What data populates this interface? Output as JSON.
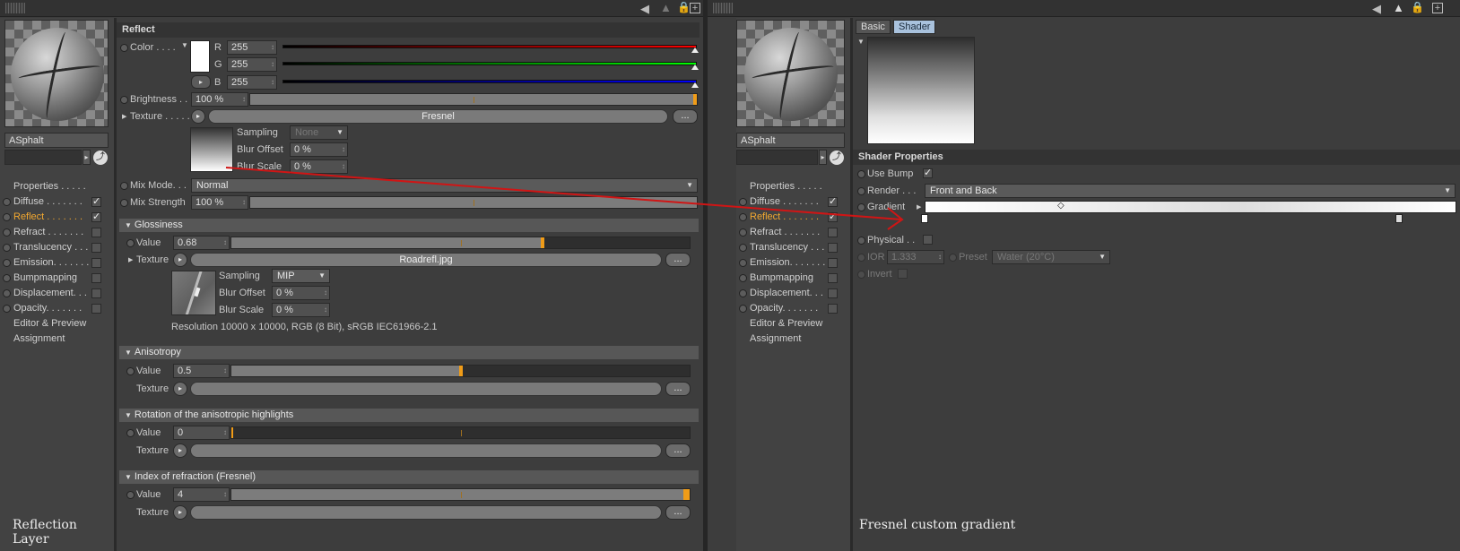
{
  "left": {
    "material_name": "ASphalt",
    "nav": [
      {
        "label": "Properties . . . . .",
        "checked": null,
        "active": false,
        "dot": false
      },
      {
        "label": "Diffuse . . . . . . .",
        "checked": true,
        "active": false,
        "dot": true
      },
      {
        "label": "Reflect . . . . . . .",
        "checked": true,
        "active": true,
        "dot": true
      },
      {
        "label": "Refract . . . . . . .",
        "checked": false,
        "active": false,
        "dot": true
      },
      {
        "label": "Translucency . . .",
        "checked": false,
        "active": false,
        "dot": true
      },
      {
        "label": "Emission. . . . . . .",
        "checked": false,
        "active": false,
        "dot": true
      },
      {
        "label": "Bumpmapping",
        "checked": false,
        "active": false,
        "dot": true
      },
      {
        "label": "Displacement. . .",
        "checked": false,
        "active": false,
        "dot": true
      },
      {
        "label": "Opacity. . . . . . .",
        "checked": false,
        "active": false,
        "dot": true
      },
      {
        "label": "Editor & Preview",
        "checked": null,
        "active": false,
        "dot": false
      },
      {
        "label": "Assignment",
        "checked": null,
        "active": false,
        "dot": false
      }
    ],
    "caption": "Reflection Layer"
  },
  "reflect": {
    "header": "Reflect",
    "color_label": "Color . . . .",
    "r_label": "R",
    "r_value": "255",
    "g_label": "G",
    "g_value": "255",
    "b_label": "B",
    "b_value": "255",
    "brightness_label": "Brightness . .",
    "brightness_value": "100 %",
    "brightness_level": 1.0,
    "texture_label": "Texture . . . . .",
    "texture_name": "Fresnel",
    "more_label": "...",
    "sampling_label": "Sampling",
    "sampling_value": "None",
    "blur_offset_label": "Blur Offset",
    "blur_offset_value": "0 %",
    "blur_scale_label": "Blur Scale",
    "blur_scale_value": "0 %",
    "mix_mode_label": "Mix Mode. . .",
    "mix_mode_value": "Normal",
    "mix_strength_label": "Mix Strength",
    "mix_strength_value": "100 %"
  },
  "glossiness": {
    "header": "Glossiness",
    "value_label": "Value",
    "value": "0.68",
    "level": 0.68,
    "texture_label": "Texture",
    "texture_name": "Roadrefl.jpg",
    "sampling_label": "Sampling",
    "sampling_value": "MIP",
    "blur_offset_label": "Blur Offset",
    "blur_offset_value": "0 %",
    "blur_scale_label": "Blur Scale",
    "blur_scale_value": "0 %",
    "resolution": "Resolution 10000 x 10000, RGB (8 Bit), sRGB IEC61966-2.1"
  },
  "anisotropy": {
    "header": "Anisotropy",
    "value_label": "Value",
    "value": "0.5",
    "level": 0.5,
    "texture_label": "Texture"
  },
  "rotation": {
    "header": "Rotation of the anisotropic highlights",
    "value_label": "Value",
    "value": "0",
    "level": 0.0,
    "texture_label": "Texture"
  },
  "ior": {
    "header": "Index of refraction (Fresnel)",
    "value_label": "Value",
    "value": "4",
    "level": 1.0,
    "texture_label": "Texture"
  },
  "right": {
    "material_name": "ASphalt",
    "tabs": [
      "Basic",
      "Shader"
    ],
    "active_tab": "Shader",
    "shader_props_header": "Shader Properties",
    "use_bump_label": "Use Bump",
    "render_label": "Render . . .",
    "render_value": "Front and Back",
    "gradient_label": "Gradient",
    "physical_label": "Physical . .",
    "ior_label": "IOR",
    "ior_value": "1.333",
    "preset_label": "Preset",
    "preset_value": "Water (20°C)",
    "invert_label": "Invert",
    "caption": "Fresnel custom gradient"
  },
  "colors": {
    "accent": "#f09c18",
    "active_nav": "#f2a830",
    "annotation_arrow": "#d01515",
    "tab_active": "#a9c2dd"
  },
  "icons": [
    "grip-icon",
    "back-arrow-icon",
    "up-arrow-icon",
    "lock-icon",
    "add-panel-icon",
    "picker-icon",
    "play-icon",
    "checkmark-icon",
    "triangle-down-icon",
    "dots-icon"
  ]
}
